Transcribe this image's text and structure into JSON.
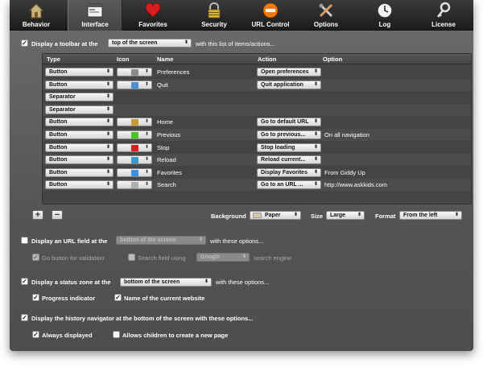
{
  "toolbar": {
    "items": [
      {
        "label": "Behavior",
        "icon": "house-icon"
      },
      {
        "label": "Interface",
        "icon": "window-icon"
      },
      {
        "label": "Favorites",
        "icon": "heart-icon"
      },
      {
        "label": "Security",
        "icon": "padlock-icon"
      },
      {
        "label": "URL Control",
        "icon": "no-entry-icon"
      },
      {
        "label": "Options",
        "icon": "tools-icon"
      },
      {
        "label": "Log",
        "icon": "clock-icon"
      },
      {
        "label": "License",
        "icon": "key-icon"
      }
    ],
    "selected": "Interface"
  },
  "toolbar_section": {
    "checked": true,
    "label_before": "Display a toolbar at the",
    "position_value": "top of the screen",
    "label_after": "with this list of items/actions..."
  },
  "table": {
    "headers": {
      "type": "Type",
      "icon": "Icon",
      "name": "Name",
      "action": "Action",
      "option": "Option"
    },
    "rows": [
      {
        "type": "Button",
        "icon": "preferences-icon",
        "name": "Preferences",
        "action": "Open preferences",
        "option": ""
      },
      {
        "type": "Button",
        "icon": "screen-icon",
        "name": "Quit",
        "action": "Quit application",
        "option": ""
      },
      {
        "type": "Separator",
        "icon": "",
        "name": "",
        "action": "",
        "option": ""
      },
      {
        "type": "Separator",
        "icon": "",
        "name": "",
        "action": "",
        "option": ""
      },
      {
        "type": "Button",
        "icon": "home-icon",
        "name": "Home",
        "action": "Go to default URL",
        "option": ""
      },
      {
        "type": "Button",
        "icon": "left-arrow-icon",
        "name": "Previous",
        "action": "Go to previous...",
        "option": "On all navigation"
      },
      {
        "type": "Button",
        "icon": "stop-icon",
        "name": "Stop",
        "action": "Stop loading",
        "option": ""
      },
      {
        "type": "Button",
        "icon": "reload-icon",
        "name": "Reload",
        "action": "Reload current...",
        "option": ""
      },
      {
        "type": "Button",
        "icon": "globe-icon",
        "name": "Favorites",
        "action": "Display Favorites",
        "option": "From Giddy Up"
      },
      {
        "type": "Button",
        "icon": "magnifier-icon",
        "name": "Search",
        "action": "Go to an URL ...",
        "option": "http://www.askkids.com"
      }
    ]
  },
  "table_controls": {
    "add_label": "+",
    "remove_label": "−",
    "background_label": "Background",
    "background_value": "Paper",
    "size_label": "Size",
    "size_value": "Large",
    "format_label": "Format",
    "format_value": "From the left"
  },
  "url_section": {
    "checked": false,
    "label_before": "Display an URL field at the",
    "position_value": "bottom of the screen",
    "label_after": "with these options...",
    "go_button_label": "Go button for validation",
    "go_button_checked": true,
    "search_field_label": "Search field using",
    "search_field_checked": false,
    "search_engine_value": "Google",
    "search_engine_suffix": "search engine"
  },
  "status_section": {
    "checked": true,
    "label_before": "Display a status zone at the",
    "position_value": "bottom of the screen",
    "label_after": "with these options...",
    "progress_label": "Progress indicator",
    "progress_checked": true,
    "website_label": "Name of the current website",
    "website_checked": true
  },
  "history_section": {
    "checked": true,
    "label": "Display the history navigator at the bottom of the screen with these options...",
    "always_label": "Always displayed",
    "always_checked": true,
    "children_label": "Allows children to create a new page",
    "children_checked": false
  }
}
